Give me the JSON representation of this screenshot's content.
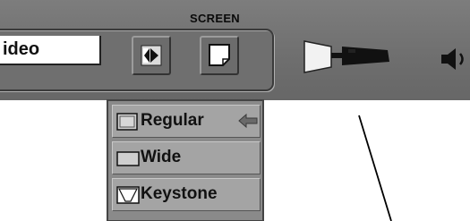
{
  "menu": {
    "group_title": "SCREEN",
    "source_value": "ideo",
    "icons": [
      "screen-size-icon",
      "screen-shape-icon",
      "projector-icon",
      "speaker-icon"
    ]
  },
  "screen_submenu": {
    "items": [
      {
        "label": "Regular",
        "icon": "regular-aspect-icon",
        "selected": true
      },
      {
        "label": "Wide",
        "icon": "wide-aspect-icon",
        "selected": false
      },
      {
        "label": "Keystone",
        "icon": "keystone-icon",
        "selected": false
      }
    ],
    "selector_icon": "left-arrow-icon"
  },
  "colors": {
    "menubar": "#757575",
    "submenu_item": "#a4a4a4",
    "text": "#111111"
  }
}
